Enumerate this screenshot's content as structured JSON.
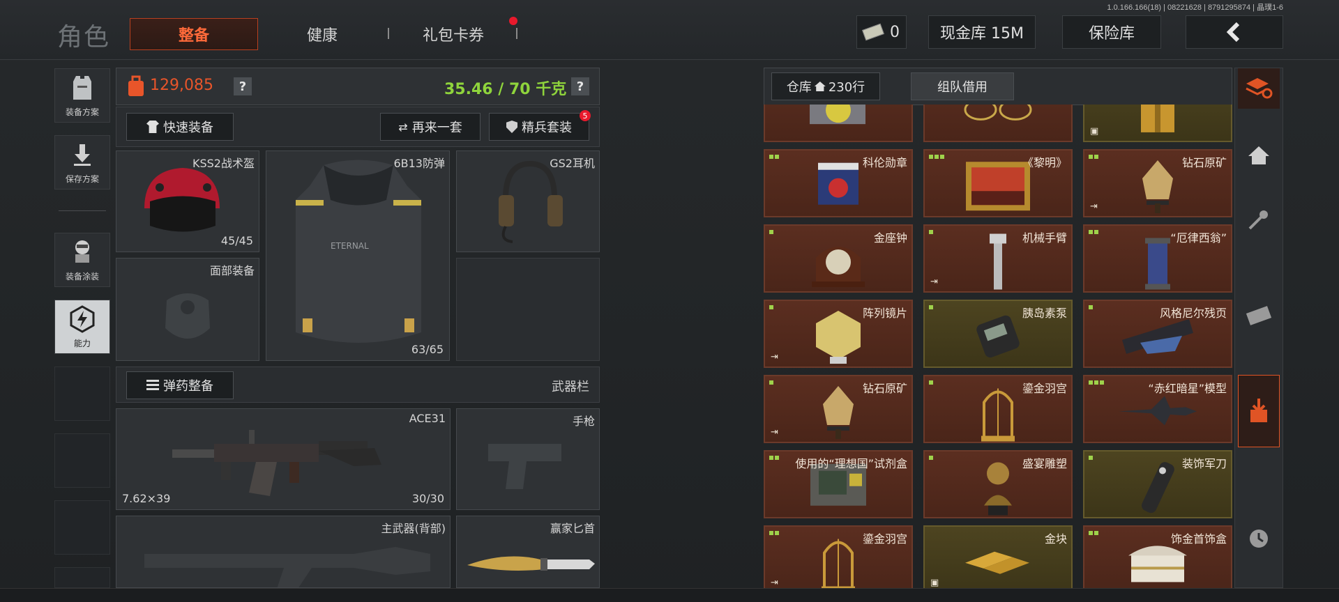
{
  "version": "1.0.166.166(18) | 08221628 | 8791295874 | 晶璞1-6",
  "page_title": "角色",
  "tabs": [
    {
      "label": "整备",
      "active": true
    },
    {
      "label": "健康",
      "active": false
    },
    {
      "label": "礼包卡券",
      "active": false,
      "badge": true
    }
  ],
  "currency": {
    "cash_count": "0",
    "cash_vault": "现金库 15M",
    "insurance": "保险库"
  },
  "left_nav": [
    {
      "label": "装备方案",
      "icon": "vest-icon"
    },
    {
      "label": "保存方案",
      "icon": "download-icon"
    },
    {
      "label": "装备涂装",
      "icon": "paint-icon"
    },
    {
      "label": "能力",
      "icon": "ability-icon",
      "active": true
    }
  ],
  "loadout": {
    "value": "129,085",
    "weight": "35.46 / 70 千克",
    "value_color": "#e8552a",
    "weight_color": "#8fd43c",
    "quick_equip": "快速装备",
    "again": "再来一套",
    "elite": "精兵套装",
    "elite_badge": "5",
    "ammo_equip": "弹药整备",
    "weapon_bar": "武器栏"
  },
  "slots": {
    "helmet": {
      "name": "KSS2战术盔",
      "durability": "45/45"
    },
    "armor": {
      "name": "6B13防弹",
      "durability": "63/65"
    },
    "headset": {
      "name": "GS2耳机"
    },
    "face": {
      "name": "面部装备"
    },
    "primary": {
      "name": "ACE31",
      "caliber": "7.62×39",
      "ammo": "30/30"
    },
    "pistol": {
      "name": "手枪"
    },
    "back": {
      "name": "主武器(背部)"
    },
    "knife": {
      "name": "赢家匕首"
    }
  },
  "inventory": {
    "tab_storage": "仓库",
    "rows": "230行",
    "tab_team": "组队借用",
    "items": [
      {
        "name": "",
        "style": "brown",
        "art": "disc"
      },
      {
        "name": "",
        "style": "brown",
        "art": "glasses"
      },
      {
        "name": "",
        "style": "gold",
        "art": "box",
        "exit": "cube"
      },
      {
        "name": "科伦勋章",
        "style": "brown",
        "dots": 2,
        "art": "medal"
      },
      {
        "name": "《黎明》",
        "style": "brown",
        "dots": 3,
        "art": "painting"
      },
      {
        "name": "钻石原矿",
        "style": "brown",
        "dots": 2,
        "art": "ore",
        "exit": "door"
      },
      {
        "name": "金座钟",
        "style": "brown",
        "dots": 1,
        "art": "clock"
      },
      {
        "name": "机械手臂",
        "style": "brown",
        "dots": 1,
        "art": "arm",
        "exit": "door"
      },
      {
        "name": "“厄律西翁”",
        "style": "brown",
        "dots": 2,
        "art": "lantern"
      },
      {
        "name": "阵列镜片",
        "style": "brown",
        "dots": 1,
        "art": "lens",
        "exit": "door"
      },
      {
        "name": "胰岛素泵",
        "style": "gold",
        "dots": 1,
        "art": "pump"
      },
      {
        "name": "风格尼尔残页",
        "style": "brown",
        "dots": 1,
        "art": "scroll"
      },
      {
        "name": "钻石原矿",
        "style": "brown",
        "dots": 1,
        "art": "ore",
        "exit": "door"
      },
      {
        "name": "鎏金羽宫",
        "style": "brown",
        "dots": 1,
        "art": "cage"
      },
      {
        "name": "“赤红暗星”模型",
        "style": "brown",
        "dots": 3,
        "art": "jet"
      },
      {
        "name": "使用的“理想国”试剂盒",
        "style": "brown",
        "dots": 2,
        "art": "kit"
      },
      {
        "name": "盛宴雕塑",
        "style": "brown",
        "dots": 1,
        "art": "bust"
      },
      {
        "name": "装饰军刀",
        "style": "gold",
        "dots": 1,
        "art": "blade"
      },
      {
        "name": "鎏金羽宫",
        "style": "brown",
        "dots": 2,
        "art": "cage",
        "exit": "door"
      },
      {
        "name": "金块",
        "style": "gold",
        "dots": 0,
        "art": "bars",
        "exit": "cube"
      },
      {
        "name": "饰金首饰盒",
        "style": "brown",
        "dots": 2,
        "art": "jewelbox"
      }
    ]
  },
  "right_nav": [
    {
      "icon": "stack-refresh-icon"
    },
    {
      "icon": "home-icon"
    },
    {
      "icon": "key-icon"
    },
    {
      "icon": "cash-icon"
    },
    {
      "icon": "deposit-icon",
      "active": true
    },
    {
      "icon": "clock-icon"
    }
  ]
}
